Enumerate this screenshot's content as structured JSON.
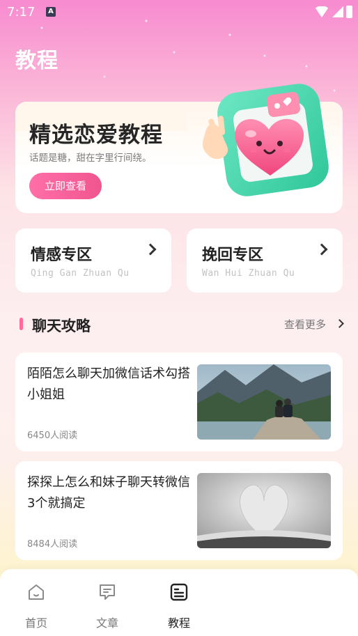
{
  "status_bar": {
    "time": "7:17",
    "app_indicator": "A"
  },
  "page": {
    "title": "教程"
  },
  "hero": {
    "title": "精选恋爱教程",
    "subtitle": "话题是糖，甜在字里行间绕。",
    "button_label": "立即查看",
    "illustration": "heart-photo-frame-icon"
  },
  "categories": [
    {
      "title": "情感专区",
      "pinyin": "Qing Gan Zhuan Qu",
      "icon": "chevron-right-icon"
    },
    {
      "title": "挽回专区",
      "pinyin": "Wan Hui Zhuan Qu",
      "icon": "chevron-right-icon"
    }
  ],
  "section": {
    "title": "聊天攻略",
    "see_more": "查看更多"
  },
  "articles": [
    {
      "title": "陌陌怎么聊天加微信话术勾搭小姐姐",
      "reads": "6450人阅读",
      "image": "couple-on-rock-lake-photo"
    },
    {
      "title": "探探上怎么和妹子聊天转微信  3个就搞定",
      "reads": "8484人阅读",
      "image": "book-heart-pages-photo"
    }
  ],
  "bottom_nav": {
    "items": [
      {
        "label": "首页",
        "icon": "home-icon",
        "active": false
      },
      {
        "label": "文章",
        "icon": "chat-icon",
        "active": false
      },
      {
        "label": "教程",
        "icon": "document-icon",
        "active": true
      }
    ]
  },
  "colors": {
    "accent": "#f0558f",
    "title_white": "#ffffff",
    "section_bar": "#ff6b9c"
  }
}
